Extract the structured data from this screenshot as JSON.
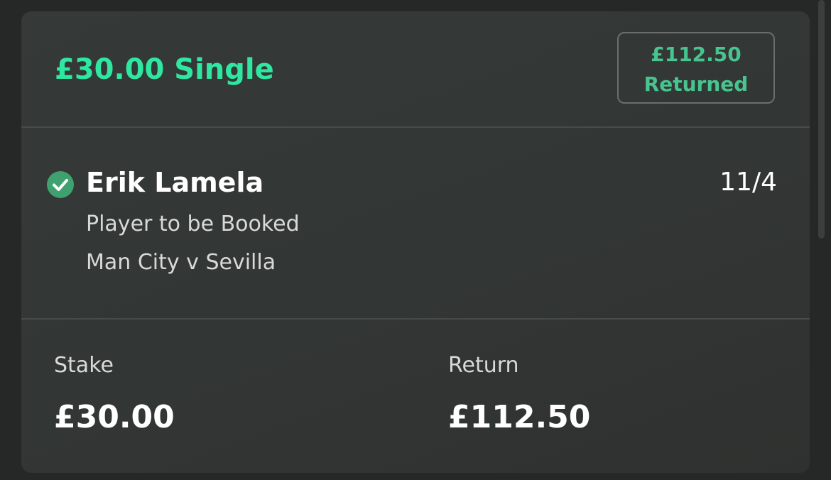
{
  "bet": {
    "title": "£30.00 Single",
    "returned_amount": "£112.50",
    "returned_label": "Returned"
  },
  "selection": {
    "status_icon": "check-circle-icon",
    "player": "Erik Lamela",
    "odds": "11/4",
    "market": "Player to be Booked",
    "event": "Man City v Sevilla"
  },
  "summary": {
    "stake_label": "Stake",
    "stake_value": "£30.00",
    "return_label": "Return",
    "return_value": "£112.50"
  },
  "colors": {
    "accent_green": "#2ee8a2",
    "badge_green": "#47c48f",
    "check_green": "#3fa16f",
    "card_background": "#343836",
    "page_background": "#262727"
  }
}
